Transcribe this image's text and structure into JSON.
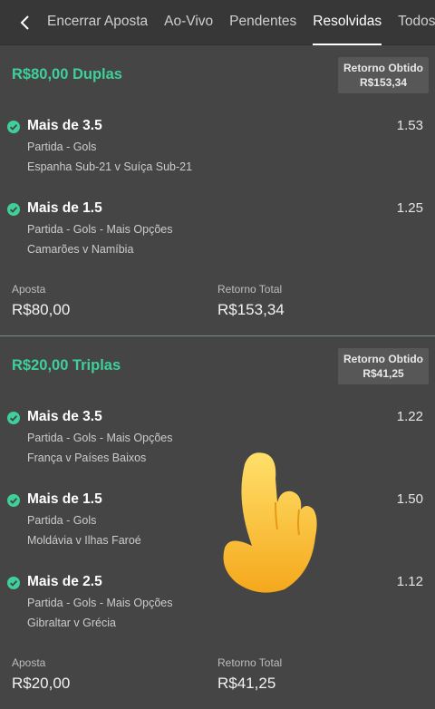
{
  "nav": {
    "back_icon": "chevron-left-icon",
    "tabs": [
      {
        "label": "Encerrar Aposta",
        "active": false
      },
      {
        "label": "Ao-Vivo",
        "active": false
      },
      {
        "label": "Pendentes",
        "active": false
      },
      {
        "label": "Resolvidas",
        "active": true
      },
      {
        "label": "Todos",
        "active": false
      }
    ]
  },
  "colors": {
    "accent": "#3ecf9a",
    "background": "#3f3f3f"
  },
  "bets": [
    {
      "title": "R$80,00 Duplas",
      "return_label": "Retorno Obtido",
      "return_value": "R$153,34",
      "selections": [
        {
          "name": "Mais de 3.5",
          "odds": "1.53",
          "market": "Partida - Gols",
          "event": "Espanha Sub-21 v Suíça Sub-21",
          "status_icon": "check-circle-icon"
        },
        {
          "name": "Mais de 1.5",
          "odds": "1.25",
          "market": "Partida - Gols - Mais Opções",
          "event": "Camarões v Namíbia",
          "status_icon": "check-circle-icon"
        }
      ],
      "stake_label": "Aposta",
      "stake_value": "R$80,00",
      "total_label": "Retorno Total",
      "total_value": "R$153,34"
    },
    {
      "title": "R$20,00 Triplas",
      "return_label": "Retorno Obtido",
      "return_value": "R$41,25",
      "selections": [
        {
          "name": "Mais de 3.5",
          "odds": "1.22",
          "market": "Partida - Gols - Mais Opções",
          "event": "França v Países Baixos",
          "status_icon": "check-circle-icon"
        },
        {
          "name": "Mais de 1.5",
          "odds": "1.50",
          "market": "Partida - Gols",
          "event": "Moldávia v Ilhas Faroé",
          "status_icon": "check-circle-icon"
        },
        {
          "name": "Mais de 2.5",
          "odds": "1.12",
          "market": "Partida - Gols - Mais Opções",
          "event": "Gibraltar v Grécia",
          "status_icon": "check-circle-icon"
        }
      ],
      "stake_label": "Aposta",
      "stake_value": "R$20,00",
      "total_label": "Retorno Total",
      "total_value": "R$41,25"
    }
  ],
  "overlay": {
    "icon": "pointing-hand-icon"
  }
}
